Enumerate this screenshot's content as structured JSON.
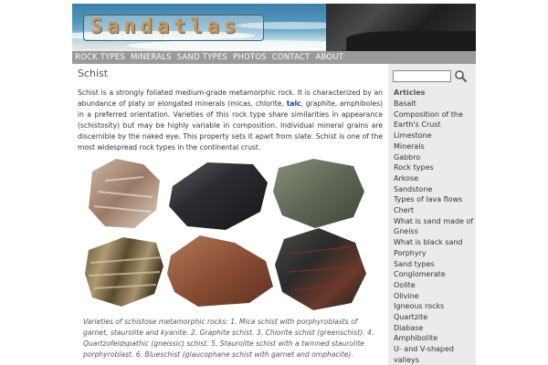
{
  "site": {
    "logo": "Sandatlas"
  },
  "nav": [
    "ROCK TYPES",
    "MINERALS",
    "SAND TYPES",
    "PHOTOS",
    "CONTACT",
    "ABOUT"
  ],
  "article": {
    "title": "Schist",
    "intro_before_link": "Schist is a strongly foliated medium-grade metamorphic rock. It is characterized by an abundance of platy or elongated minerals (micas, chlorite, ",
    "link": "talc",
    "intro_after_link": ", graphite, amphiboles) in a preferred orientation. Varieties of this rock type share similarities in appearance (schistosity) but may be highly variable in composition. Individual mineral grains are discernible by the naked eye. This property sets it apart from slate. Schist is one of the most widespread rock types in the continental crust.",
    "caption": "Varieties of schistose metamorphic rocks: 1. Mica schist with porphyroblasts of garnet, staurolite and kyanite. 2. Graphite schist. 3. Chlorite schist (greenschist). 4. Quartzofeldspathic (gneissic) schist. 5. Staurolite schist with a twinned staurolite porphyroblast. 6. Blueschist (glaucophane schist with garnet and omphacite)."
  },
  "sidebar": {
    "search_placeholder": "",
    "articles_heading": "Articles",
    "articles": [
      "Basalt",
      "Composition of the",
      "Earth's Crust",
      "Limestone",
      "Minerals",
      "Gabbro",
      "Rock types",
      "Arkose",
      "Sandstone",
      "Types of lava flows",
      "Chert",
      "What is sand made of",
      "Gneiss",
      "What is black sand",
      "Porphyry",
      "Sand types",
      "Conglomerate",
      "Oolite",
      "Olivine",
      "Igneous rocks",
      "Quartzite",
      "Diabase",
      "Amphibolite",
      "U- and V-shaped",
      "valleys"
    ]
  },
  "colors": {
    "nav_bg": "#9a9a9a",
    "sidebar_bg": "#ebebeb",
    "link": "#1b3f9e",
    "logo": "#c9955c"
  },
  "icons": {
    "search": "magnifier-icon"
  }
}
